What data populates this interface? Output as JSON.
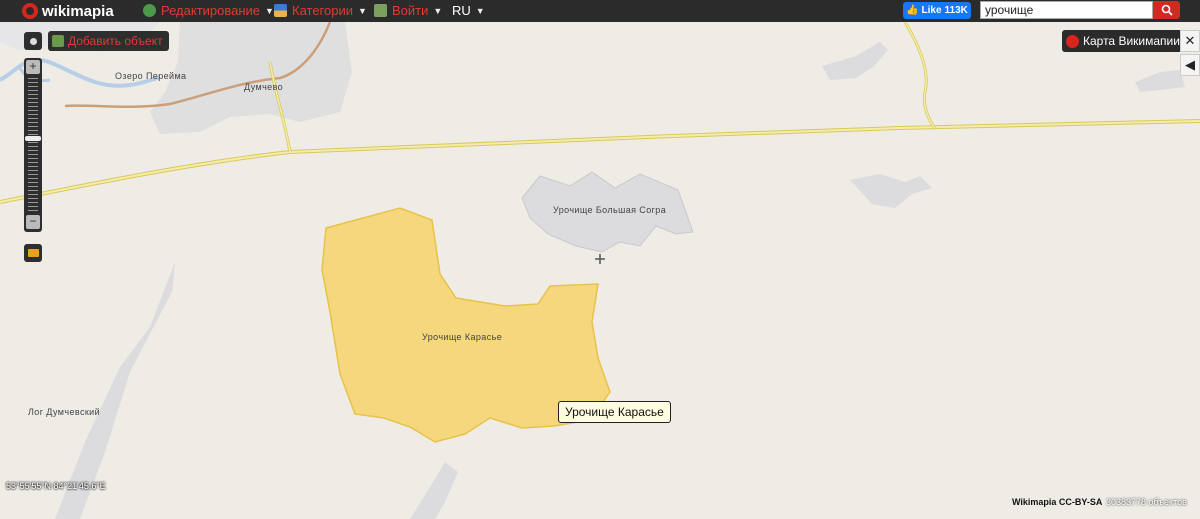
{
  "header": {
    "logo": "wikimapia",
    "menu": [
      {
        "label": "Редактирование",
        "icon": "edit-globe-icon"
      },
      {
        "label": "Категории",
        "icon": "categories-icon"
      },
      {
        "label": "Войти",
        "icon": "login-icon"
      },
      {
        "label": "RU",
        "icon": ""
      }
    ],
    "like_label": "Like",
    "like_count": "113K",
    "search_value": "урочище"
  },
  "map": {
    "add_object": "Добавить объект",
    "wikimapia_map_button": "Карта Викимапии",
    "labels": {
      "lake": "Озеро Перейма",
      "village": "Думчево",
      "bolshaya_sogra": "Урочище Большая Согра",
      "karasie": "Урочище Карасье",
      "log": "Лог Думчевский"
    },
    "tooltip": "Урочище Карасье",
    "coords": "53°55'55\"N 84°21'45.6\"E",
    "license": "Wikimapia CC-BY-SA",
    "object_count": "30383778 объектов",
    "colors": {
      "topbar": "#2b2b2b",
      "accent": "#d8261f",
      "polygon": "#f5d77e",
      "road": "#f0e68c"
    }
  }
}
